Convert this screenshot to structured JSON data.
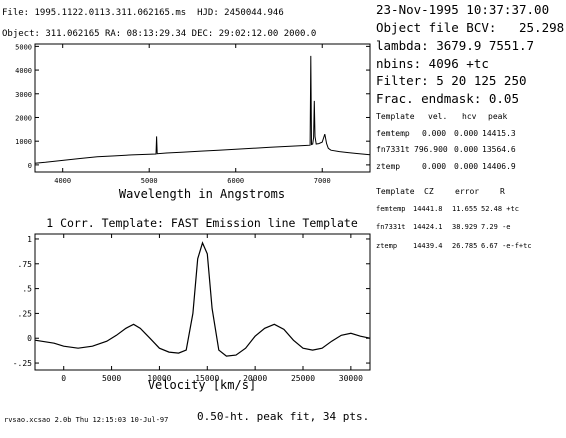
{
  "header": {
    "file_line": "File: 1995.1122.0113.311.062165.ms  HJD: 2450044.946",
    "object_line": "Object: 311.062165 RA: 08:13:29.34 DEC: 29:02:12.00 2000.0"
  },
  "info": {
    "date_line": "23-Nov-1995 10:37:37.00",
    "bcv_line": "Object file BCV:   25.298",
    "lambda_line": "lambda: 3679.9 7551.7",
    "nbins_line": "nbins: 4096 +tc",
    "filter_line": "Filter: 5 20 125 250",
    "frac_line": "Frac. endmask: 0.05"
  },
  "table1": {
    "headers": [
      "Template",
      "vel.",
      "hcv",
      "peak"
    ],
    "rows": [
      [
        "femtemp",
        "0.000",
        "0.000",
        "14415.3"
      ],
      [
        "fn7331t",
        "796.900",
        "0.000",
        "13564.6"
      ],
      [
        "ztemp",
        "0.000",
        "0.000",
        "14406.9"
      ]
    ]
  },
  "table2": {
    "headers": [
      "Template",
      "CZ",
      "error",
      "R"
    ],
    "rows": [
      [
        "femtemp",
        "14441.8",
        "11.655",
        "52.48 +tc"
      ],
      [
        "fn7331t",
        "14424.1",
        "38.929",
        "7.29 -e"
      ],
      [
        "ztemp",
        "14439.4",
        "26.785",
        "6.67 -e-f+tc"
      ]
    ]
  },
  "footer": {
    "version_line": "rvsao.xcsao 2.0b Thu 12:15:03 10-Jul-97",
    "fit_line": "0.50-ht. peak fit, 34 pts."
  },
  "chart_data": [
    {
      "type": "line",
      "title": "",
      "xlabel": "Wavelength in Angstroms",
      "ylabel": "",
      "xlim": [
        3680,
        7552
      ],
      "ylim": [
        -300,
        5100
      ],
      "x_ticks": [
        4000,
        5000,
        6000,
        7000
      ],
      "y_ticks": [
        0,
        1000,
        2000,
        3000,
        4000,
        5000
      ],
      "grid": false,
      "series": [
        {
          "x": [
            3680,
            3800,
            4000,
            4200,
            4400,
            4600,
            4800,
            5000,
            5078,
            5085,
            5092,
            5200,
            5400,
            5600,
            5800,
            6000,
            6200,
            6400,
            6600,
            6800,
            6860,
            6868,
            6876,
            6890,
            6900,
            6908,
            6916,
            6930,
            6960,
            7000,
            7030,
            7050,
            7070,
            7100,
            7200,
            7300,
            7400,
            7552
          ],
          "y": [
            70,
            110,
            190,
            270,
            340,
            380,
            420,
            450,
            460,
            1200,
            470,
            500,
            540,
            580,
            620,
            660,
            700,
            740,
            780,
            820,
            830,
            4600,
            860,
            880,
            1150,
            2700,
            1200,
            880,
            900,
            960,
            1300,
            900,
            700,
            620,
            560,
            520,
            480,
            430
          ]
        }
      ]
    },
    {
      "type": "line",
      "title": "1 Corr. Template: FAST Emission line Template",
      "xlabel": "Velocity [km/s]",
      "ylabel": "",
      "xlim": [
        -3000,
        32000
      ],
      "ylim": [
        -0.32,
        1.05
      ],
      "x_ticks": [
        0,
        5000,
        10000,
        15000,
        20000,
        25000,
        30000
      ],
      "y_ticks": [
        -0.25,
        0,
        0.25,
        0.5,
        0.75,
        1
      ],
      "y_tick_labels": [
        "-.25",
        "0",
        ".25",
        ".5",
        ".75",
        "1"
      ],
      "grid": false,
      "series": [
        {
          "x": [
            -3000,
            -1000,
            0,
            1500,
            3000,
            4500,
            5500,
            6500,
            7300,
            8000,
            9000,
            10000,
            11000,
            12000,
            12800,
            13500,
            14000,
            14500,
            15000,
            15500,
            16200,
            17000,
            18000,
            19000,
            20000,
            21000,
            22000,
            23000,
            24000,
            25000,
            26000,
            27000,
            28000,
            29000,
            30000,
            31000,
            32000
          ],
          "y": [
            -0.02,
            -0.05,
            -0.08,
            -0.1,
            -0.08,
            -0.03,
            0.03,
            0.1,
            0.14,
            0.1,
            0.0,
            -0.1,
            -0.14,
            -0.15,
            -0.12,
            0.25,
            0.8,
            0.96,
            0.85,
            0.3,
            -0.12,
            -0.18,
            -0.17,
            -0.1,
            0.02,
            0.1,
            0.14,
            0.09,
            -0.02,
            -0.1,
            -0.12,
            -0.1,
            -0.03,
            0.03,
            0.05,
            0.02,
            0.0
          ]
        }
      ]
    }
  ]
}
